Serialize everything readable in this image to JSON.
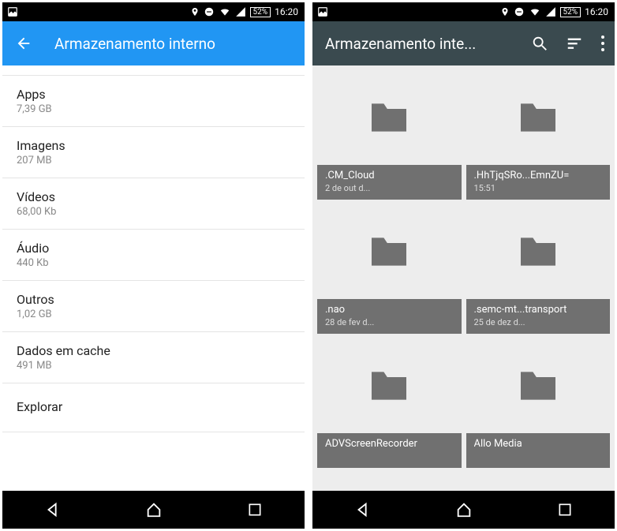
{
  "status": {
    "battery": "52%",
    "time": "16:20"
  },
  "left": {
    "title": "Armazenamento interno",
    "items": [
      {
        "label": "Apps",
        "size": "7,39 GB"
      },
      {
        "label": "Imagens",
        "size": "207 MB"
      },
      {
        "label": "Vídeos",
        "size": "68,00 Kb"
      },
      {
        "label": "Áudio",
        "size": "440 Kb"
      },
      {
        "label": "Outros",
        "size": "1,02 GB"
      },
      {
        "label": "Dados em cache",
        "size": "491 MB"
      },
      {
        "label": "Explorar",
        "size": ""
      }
    ]
  },
  "right": {
    "title": "Armazenamento inte...",
    "folders": [
      {
        "name": ".CM_Cloud",
        "date": "2 de out d..."
      },
      {
        "name": ".HhTjqSRo...EmnZU=",
        "date": "15:51"
      },
      {
        "name": ".nao",
        "date": "28 de fev d..."
      },
      {
        "name": ".semc-mt...transport",
        "date": "25 de dez d..."
      },
      {
        "name": "ADVScreenRecorder",
        "date": ""
      },
      {
        "name": "Allo Media",
        "date": ""
      }
    ]
  }
}
